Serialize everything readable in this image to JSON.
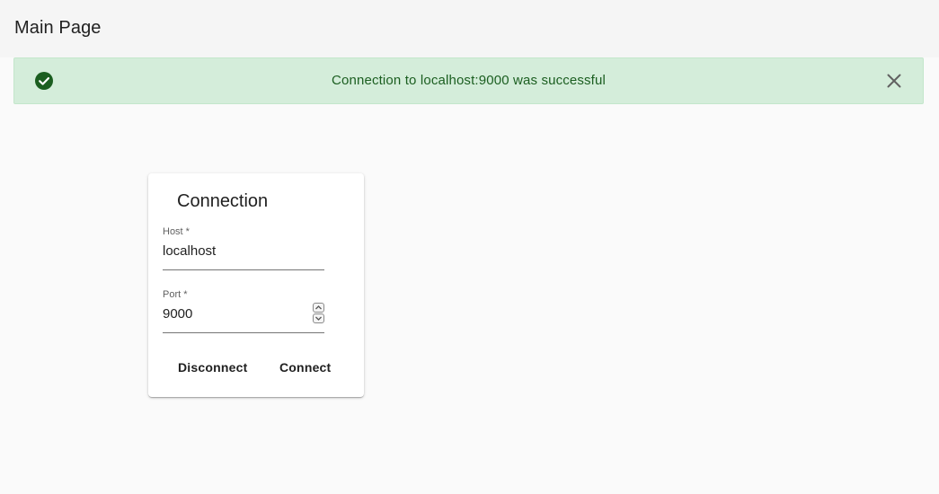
{
  "header": {
    "title": "Main Page"
  },
  "alert": {
    "message": "Connection to localhost:9000 was successful",
    "icon": "check-circle-icon",
    "close_icon": "close-icon",
    "background": "#d4edda",
    "text_color": "#1b5e20"
  },
  "connection_card": {
    "title": "Connection",
    "host": {
      "label": "Host *",
      "value": "localhost"
    },
    "port": {
      "label": "Port *",
      "value": "9000"
    },
    "buttons": {
      "disconnect": "Disconnect",
      "connect": "Connect"
    }
  }
}
